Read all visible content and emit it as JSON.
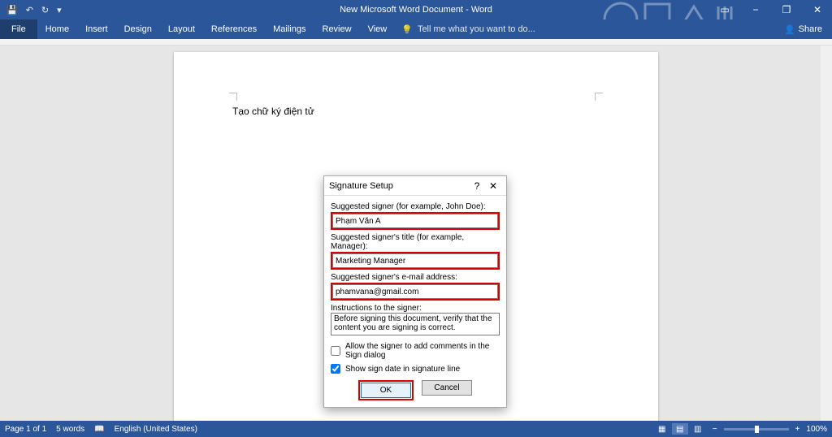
{
  "titlebar": {
    "app_title": "New Microsoft Word Document - Word",
    "win_minimize": "−",
    "win_restore": "❐",
    "win_close": "✕"
  },
  "ribbon": {
    "file": "File",
    "tabs": [
      "Home",
      "Insert",
      "Design",
      "Layout",
      "References",
      "Mailings",
      "Review",
      "View"
    ],
    "tellme_placeholder": "Tell me what you want to do...",
    "share": "Share"
  },
  "document": {
    "body_text": "Tạo chữ ký điện tử"
  },
  "dialog": {
    "title": "Signature Setup",
    "help": "?",
    "close": "✕",
    "signer_label": "Suggested signer (for example, John Doe):",
    "signer_value": "Phạm Văn A",
    "title_label": "Suggested signer's title (for example, Manager):",
    "title_value": "Marketing Manager",
    "email_label": "Suggested signer's e-mail address:",
    "email_value": "phamvana@gmail.com",
    "instr_label": "Instructions to the signer:",
    "instr_value": "Before signing this document, verify that the content you are signing is correct.",
    "allow_comments": "Allow the signer to add comments in the Sign dialog",
    "show_date": "Show sign date in signature line",
    "ok": "OK",
    "cancel": "Cancel",
    "allow_comments_checked": false,
    "show_date_checked": true
  },
  "statusbar": {
    "page": "Page 1 of 1",
    "words": "5 words",
    "lang": "English (United States)",
    "zoom_minus": "−",
    "zoom_plus": "+",
    "zoom_value": "100%"
  }
}
